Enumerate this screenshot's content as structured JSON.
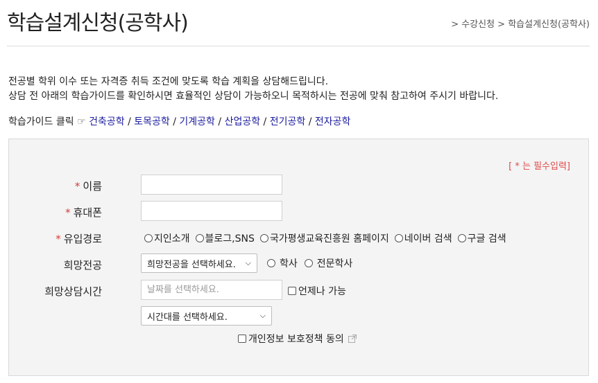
{
  "page": {
    "title": "학습설계신청(공학사)",
    "breadcrumb": "> 수강신청 > 학습설계신청(공학사)"
  },
  "intro": {
    "line1": "전공별 학위 이수 또는 자격증 취득 조건에 맞도록 학습 계획을 상담해드립니다.",
    "line2": "상담 전 아래의 학습가이드를 확인하시면 효율적인 상담이 가능하오니 목적하시는 전공에 맞춰 참고하여 주시기 바랍니다."
  },
  "guide": {
    "prefix": "학습가이드 클릭",
    "hand": "☞",
    "separator": " / ",
    "links": [
      "건축공학",
      "토목공학",
      "기계공학",
      "산업공학",
      "전기공학",
      "전자공학"
    ]
  },
  "form": {
    "required_note": "[ * 는 필수입력]",
    "required_star": "*",
    "name": {
      "label": "이름",
      "value": ""
    },
    "phone": {
      "label": "휴대폰",
      "value": ""
    },
    "referral": {
      "label": "유입경로",
      "options": [
        "지인소개",
        "블로그,SNS",
        "국가평생교육진흥원 홈페이지",
        "네이버 검색",
        "구글 검색"
      ]
    },
    "major": {
      "label": "희망전공",
      "select_value": "희망전공을 선택하세요.",
      "degree_options": [
        "학사",
        "전문학사"
      ]
    },
    "time": {
      "label": "희망상담시간",
      "date_placeholder": "날짜를 선택하세요.",
      "anytime_label": "언제나 가능",
      "time_select_value": "시간대를 선택하세요."
    },
    "privacy_label": "개인정보 보호정책 동의"
  }
}
